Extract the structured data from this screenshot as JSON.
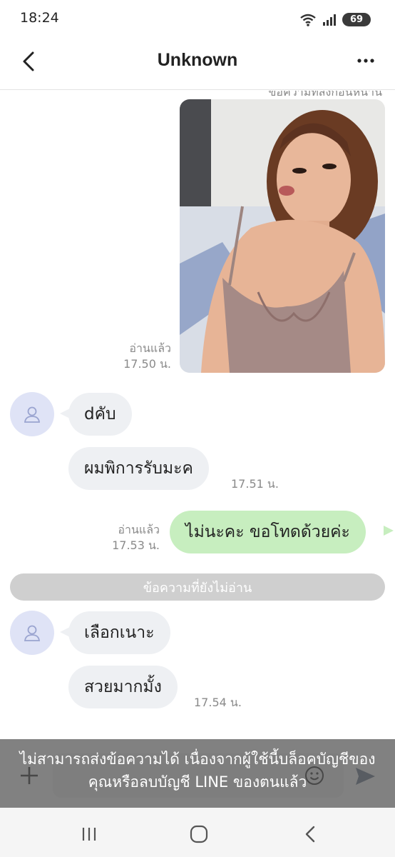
{
  "status_bar": {
    "time": "18:24",
    "battery": "69",
    "icons": [
      "wifi-icon",
      "signal-icon",
      "battery-icon"
    ]
  },
  "header": {
    "title": "Unknown"
  },
  "messages": {
    "cut_text": "ข้อความที่ส่งก่อนหน้านี้",
    "photo": {
      "read": "อ่านแล้ว",
      "time": "17.50 น."
    },
    "m1": {
      "text": "dคับ"
    },
    "m2": {
      "text": "ผมพิการรับมะค",
      "time": "17.51 น."
    },
    "m3": {
      "text": "ไม่นะคะ ขอโทดด้วยค่ะ",
      "read": "อ่านแล้ว",
      "time": "17.53 น."
    },
    "divider": "ข้อความที่ยังไม่อ่าน",
    "m4": {
      "text": "เลือกเนาะ"
    },
    "m5": {
      "text": "สวยมากมั้ง",
      "time": "17.54 น."
    }
  },
  "block_notice": {
    "line1": "ไม่สามารถส่งข้อความได้ เนื่องจากผู้ใช้นี้บล็อคบัญชีของ",
    "line2": "คุณหรือลบบัญชี LINE ของตนแล้ว"
  },
  "colors": {
    "outgoing_bubble": "#c7eebf",
    "incoming_bubble": "#eef0f3",
    "avatar_bg": "#dfe3f6",
    "send_accent": "#6b7a8f"
  }
}
